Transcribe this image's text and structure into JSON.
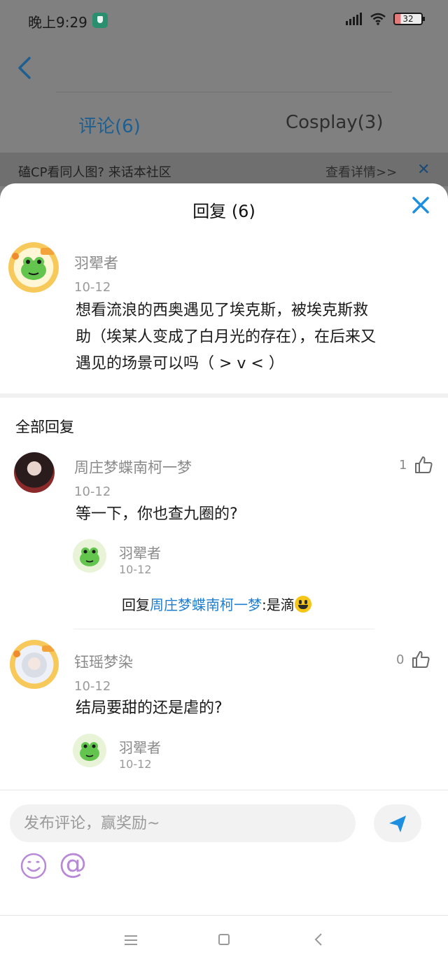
{
  "status_bar": {
    "time": "晚上9:29",
    "battery": "32"
  },
  "header": {
    "tabs": [
      {
        "label": "评论(6)",
        "active": true
      },
      {
        "label": "Cosplay(3)",
        "active": false
      }
    ],
    "banner": {
      "text": "磕CP看同人图? 来话本社区",
      "link": "查看详情>>"
    }
  },
  "sheet": {
    "title": "回复 (6)",
    "main_comment": {
      "author": "羽翚者",
      "date": "10-12",
      "lines": [
        "想看流浪的西奥遇见了埃克斯，被埃克斯救",
        "助（埃某人变成了白月光的存在），在后来又",
        "遇见的场景可以吗（ > v < ）"
      ]
    },
    "section_title": "全部回复",
    "replies": [
      {
        "author": "周庄梦蝶南柯一梦",
        "date": "10-12",
        "text": "等一下，你也查九圈的?",
        "likes": "1",
        "sub_reply": {
          "author": "羽翚者",
          "date": "10-12",
          "prefix": "回复",
          "mention": "周庄梦蝶南柯一梦",
          "text": ":是滴"
        }
      },
      {
        "author": "钰瑶梦染",
        "date": "10-12",
        "text": "结局要甜的还是虐的?",
        "likes": "0",
        "sub_reply": {
          "author": "羽翚者",
          "date": "10-12"
        }
      }
    ]
  },
  "composer": {
    "placeholder": "发布评论，赢奖励~"
  },
  "colors": {
    "accent": "#1e8ee0",
    "mention": "#1e7ed0",
    "at_icon": "#b789d6"
  },
  "icons": [
    "back-icon",
    "close-icon",
    "thumb-up-icon",
    "send-icon",
    "emoji-icon",
    "at-icon",
    "menu-icon",
    "home-icon",
    "nav-back-icon"
  ]
}
